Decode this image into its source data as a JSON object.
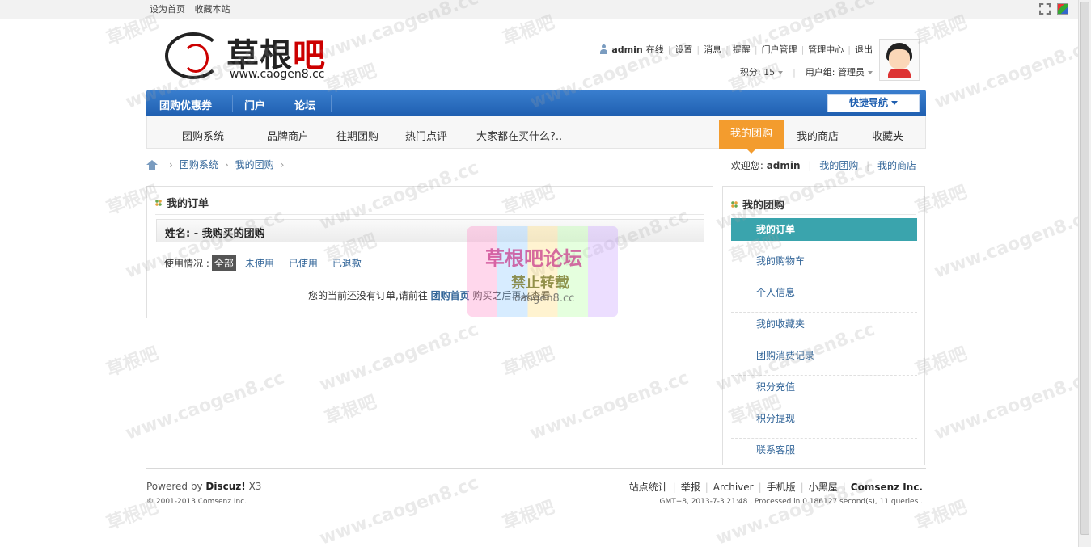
{
  "topbar": {
    "links": [
      "设为首页",
      "收藏本站"
    ]
  },
  "header": {
    "logo_cn": "草根",
    "logo_cn_red": "吧",
    "logo_url": "www.caogen8.cc"
  },
  "userbar": {
    "username": "admin",
    "status": "在线",
    "links": [
      "设置",
      "消息",
      "提醒",
      "门户管理",
      "管理中心",
      "退出"
    ],
    "credits": "积分: 15",
    "usergroup": "用户组: 管理员"
  },
  "mainnav": {
    "items": [
      "团购优惠券",
      "门户",
      "论坛"
    ],
    "quicknav": "快捷导航"
  },
  "subnav": {
    "items": [
      "团购系统",
      "品牌商户",
      "往期团购",
      "热门点评",
      "大家都在买什么?.."
    ],
    "active": "我的团购",
    "right_items": [
      "我的商店",
      "收藏夹"
    ]
  },
  "breadcrumb": {
    "items": [
      "团购系统",
      "我的团购"
    ]
  },
  "welcome": {
    "prefix": "欢迎您:",
    "user": "admin",
    "links": [
      "我的团购",
      "我的商店"
    ]
  },
  "panel": {
    "title": "我的订单",
    "namebar": "姓名: - 我购买的团购",
    "filter_label": "使用情况 :",
    "filters": [
      "全部",
      "未使用",
      "已使用",
      "已退款"
    ],
    "empty_before": "您的当前还没有订单,请前往",
    "empty_link": "团购首页",
    "empty_after": "购买之后再来查看"
  },
  "side": {
    "title": "我的团购",
    "items": [
      "我的订单",
      "我的购物车",
      "个人信息",
      "我的收藏夹",
      "团购消费记录",
      "积分充值",
      "积分提现",
      "联系客服"
    ]
  },
  "footer": {
    "powered_prefix": "Powered by",
    "powered_brand": "Discuz!",
    "powered_version": "X3",
    "copyright": "© 2001-2013 Comsenz Inc.",
    "links": [
      "站点统计",
      "举报",
      "Archiver",
      "手机版",
      "小黑屋"
    ],
    "company": "Comsenz Inc.",
    "gmt": "GMT+8, 2013-7-3 21:48 , Processed in 0.186127 second(s), 11 queries ."
  },
  "watermark": {
    "stamp_title": "草根吧论坛",
    "stamp_sub": "禁止转载",
    "stamp_url": "caogen8.cc",
    "tile_text": "草根吧",
    "tile_url": "www.caogen8.cc"
  },
  "colors": {
    "nav_blue": "#1f5fb0",
    "active_orange": "#f39c2e",
    "side_active_teal": "#3aa4ad",
    "link": "#336699"
  }
}
